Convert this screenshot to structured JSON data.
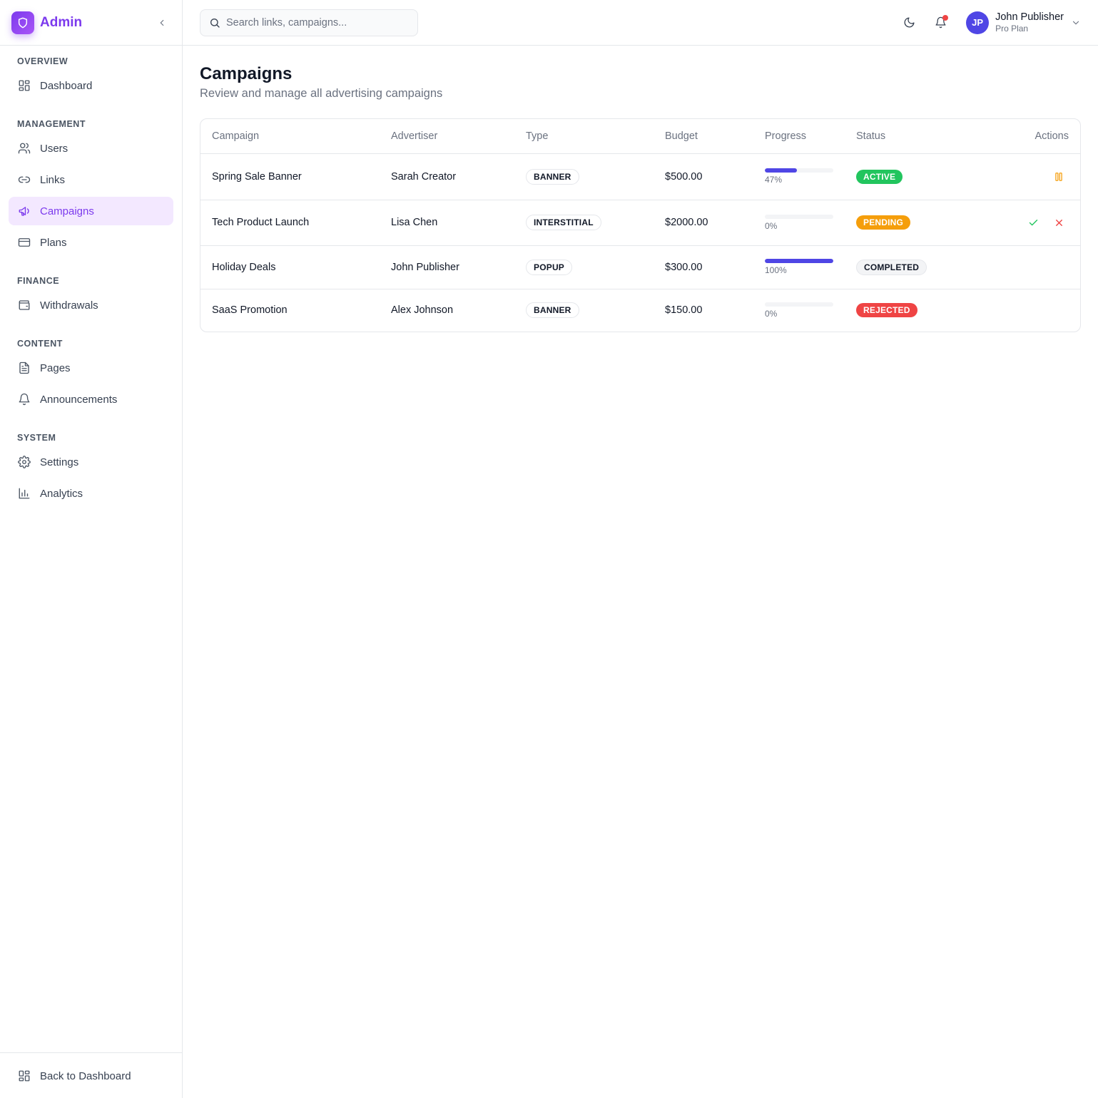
{
  "brand": {
    "name": "Admin"
  },
  "sidebar": {
    "sections": [
      {
        "title": "OVERVIEW",
        "items": [
          {
            "label": "Dashboard",
            "icon": "grid-icon"
          }
        ]
      },
      {
        "title": "MANAGEMENT",
        "items": [
          {
            "label": "Users",
            "icon": "users-icon"
          },
          {
            "label": "Links",
            "icon": "link-icon"
          },
          {
            "label": "Campaigns",
            "icon": "megaphone-icon",
            "active": true
          },
          {
            "label": "Plans",
            "icon": "credit-card-icon"
          }
        ]
      },
      {
        "title": "FINANCE",
        "items": [
          {
            "label": "Withdrawals",
            "icon": "wallet-icon"
          }
        ]
      },
      {
        "title": "CONTENT",
        "items": [
          {
            "label": "Pages",
            "icon": "file-text-icon"
          },
          {
            "label": "Announcements",
            "icon": "bell-icon"
          }
        ]
      },
      {
        "title": "SYSTEM",
        "items": [
          {
            "label": "Settings",
            "icon": "gear-icon"
          },
          {
            "label": "Analytics",
            "icon": "bar-chart-icon"
          }
        ]
      }
    ],
    "footer": {
      "label": "Back to Dashboard",
      "icon": "grid-icon"
    }
  },
  "header": {
    "search_placeholder": "Search links, campaigns...",
    "search_value": "",
    "user": {
      "initials": "JP",
      "name": "John Publisher",
      "plan": "Pro Plan"
    },
    "has_notification": true
  },
  "page": {
    "title": "Campaigns",
    "subtitle": "Review and manage all advertising campaigns"
  },
  "table": {
    "columns": [
      "Campaign",
      "Advertiser",
      "Type",
      "Budget",
      "Progress",
      "Status",
      "Actions"
    ],
    "rows": [
      {
        "campaign": "Spring Sale Banner",
        "advertiser": "Sarah Creator",
        "type": "BANNER",
        "budget": "$500.00",
        "progress": 47,
        "progress_label": "47%",
        "status": "ACTIVE",
        "status_key": "active",
        "actions": [
          "pause"
        ]
      },
      {
        "campaign": "Tech Product Launch",
        "advertiser": "Lisa Chen",
        "type": "INTERSTITIAL",
        "budget": "$2000.00",
        "progress": 0,
        "progress_label": "0%",
        "status": "PENDING",
        "status_key": "pending",
        "actions": [
          "approve",
          "reject"
        ]
      },
      {
        "campaign": "Holiday Deals",
        "advertiser": "John Publisher",
        "type": "POPUP",
        "budget": "$300.00",
        "progress": 100,
        "progress_label": "100%",
        "status": "COMPLETED",
        "status_key": "completed",
        "actions": []
      },
      {
        "campaign": "SaaS Promotion",
        "advertiser": "Alex Johnson",
        "type": "BANNER",
        "budget": "$150.00",
        "progress": 0,
        "progress_label": "0%",
        "status": "REJECTED",
        "status_key": "rejected",
        "actions": []
      }
    ]
  },
  "colors": {
    "brand": "#7c3aed",
    "progress": "#4f46e5",
    "active": "#22c55e",
    "pending": "#f59e0b",
    "rejected": "#ef4444",
    "pause_action": "#f59e0b",
    "approve_action": "#22c55e",
    "reject_action": "#ef4444"
  }
}
